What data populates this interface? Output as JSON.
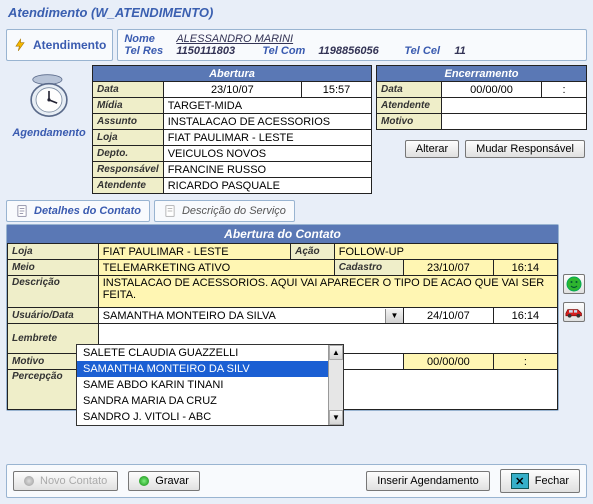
{
  "window": {
    "title": "Atendimento (W_ATENDIMENTO)"
  },
  "header": {
    "box_title": "Atendimento",
    "nome_label": "Nome",
    "nome_value": "ALESSANDRO MARINI",
    "telres_label": "Tel Res",
    "telres_value": "1150111803",
    "telcom_label": "Tel Com",
    "telcom_value": "1198856056",
    "telcel_label": "Tel Cel",
    "telcel_value": "11"
  },
  "agenda": {
    "label": "Agendamento"
  },
  "abertura": {
    "title": "Abertura",
    "data_label": "Data",
    "data_value": "23/10/07",
    "hora_value": "15:57",
    "midia_label": "Mídia",
    "midia_value": "TARGET-MIDA",
    "assunto_label": "Assunto",
    "assunto_value": "INSTALACAO DE ACESSORIOS",
    "loja_label": "Loja",
    "loja_value": "FIAT PAULIMAR - LESTE",
    "depto_label": "Depto.",
    "depto_value": "VEICULOS NOVOS",
    "resp_label": "Responsável",
    "resp_value": "FRANCINE RUSSO",
    "atend_label": "Atendente",
    "atend_value": "RICARDO PASQUALE"
  },
  "encerramento": {
    "title": "Encerramento",
    "data_label": "Data",
    "data_value": "00/00/00",
    "hora_value": ":",
    "atend_label": "Atendente",
    "atend_value": "",
    "motivo_label": "Motivo",
    "motivo_value": ""
  },
  "buttons": {
    "alterar": "Alterar",
    "mudar_resp": "Mudar Responsável",
    "novo_contato": "Novo Contato",
    "gravar": "Gravar",
    "inserir_agend": "Inserir Agendamento",
    "fechar": "Fechar"
  },
  "tabs": {
    "detalhes": "Detalhes do Contato",
    "descricao": "Descrição do Serviço"
  },
  "contato": {
    "header": "Abertura do Contato",
    "loja_label": "Loja",
    "loja_value": "FIAT PAULIMAR - LESTE",
    "acao_label": "Ação",
    "acao_value": "FOLLOW-UP",
    "meio_label": "Meio",
    "meio_value": "TELEMARKETING ATIVO",
    "cadastro_label": "Cadastro",
    "cadastro_date": "23/10/07",
    "cadastro_time": "16:14",
    "desc_label": "Descrição",
    "desc_value": "INSTALACAO DE ACESSORIOS. AQUI VAI APARECER O TIPO DE ACAO QUE VAI SER FEITA.",
    "usuario_label": "Usuário/Data",
    "usuario_value": "SAMANTHA MONTEIRO DA SILVA",
    "usuario_date": "24/10/07",
    "usuario_time": "16:14",
    "lembrete_label": "Lembrete",
    "motivo_label": "Motivo",
    "motivo_date": "00/00/00",
    "motivo_time": ":",
    "percepcao_label": "Percepção"
  },
  "dropdown": {
    "options": [
      "SALETE CLAUDIA GUAZZELLI",
      "SAMANTHA MONTEIRO DA SILV",
      "SAME ABDO KARIN TINANI",
      "SANDRA MARIA DA CRUZ",
      "SANDRO J. VITOLI - ABC"
    ],
    "selected_index": 1
  }
}
